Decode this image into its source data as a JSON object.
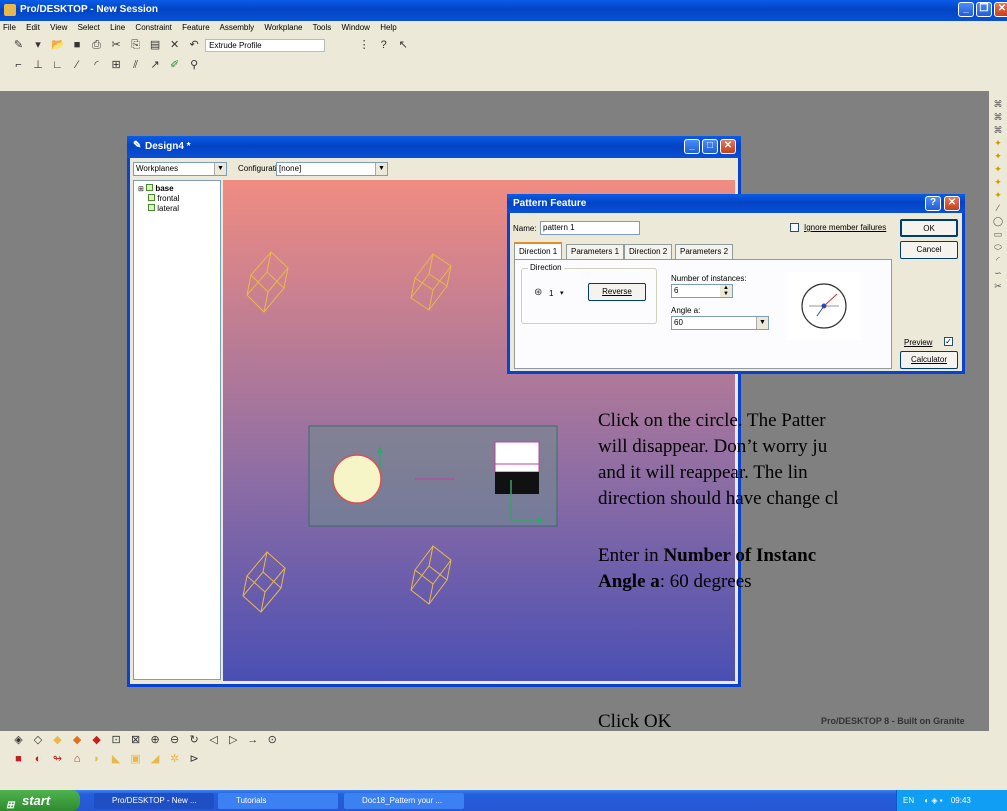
{
  "app": {
    "title": "Pro/DESKTOP - New Session",
    "menu": [
      "File",
      "Edit",
      "View",
      "Select",
      "Line",
      "Constraint",
      "Feature",
      "Assembly",
      "Workplane",
      "Tools",
      "Window",
      "Help"
    ],
    "toolbar_undo_label": "Extrude Profile",
    "branding": "Pro/DESKTOP 8 - Built on Granite"
  },
  "design_window": {
    "title": "Design4 *",
    "browser_select": "Workplanes",
    "config_label": "Configuration:",
    "config_value": "[none]",
    "tree": [
      "base",
      "frontal",
      "lateral"
    ]
  },
  "dialog": {
    "title": "Pattern Feature",
    "name_label": "Name:",
    "name_value": "pattern 1",
    "ignore_label": "Ignore member failures",
    "ok": "OK",
    "cancel": "Cancel",
    "tabs": [
      "Direction 1",
      "Parameters 1",
      "Direction 2",
      "Parameters 2"
    ],
    "direction_group": "Direction",
    "direction_value": "1",
    "reverse": "Reverse",
    "instances_label": "Number of instances:",
    "instances_value": "6",
    "angle_label": "Angle a:",
    "angle_value": "60",
    "preview": "Preview",
    "calculator": "Calculator"
  },
  "document": {
    "para1": [
      "Click on the circle. The Patter",
      "will disappear. Don’t worry ju",
      "and it will reappear. The lin",
      "direction should have change  cl"
    ],
    "para2_prefix": "Enter in ",
    "para2_bold": "Number of Instanc",
    "para3_bold": "Angle a",
    "para3_rest": ": 60 degrees",
    "para4": "Click OK"
  },
  "taskbar": {
    "start": "start",
    "items": [
      "Pro/DESKTOP - New ...",
      "Tutorials",
      "Doc18_Pattern your ..."
    ],
    "lang": "EN",
    "clock": "09:43"
  },
  "colors": {
    "canvas_top": "#f08c82",
    "canvas_bottom": "#4a4fb4",
    "xp_blue": "#0a5ce8",
    "sketch_yellow": "#e8b84a"
  }
}
